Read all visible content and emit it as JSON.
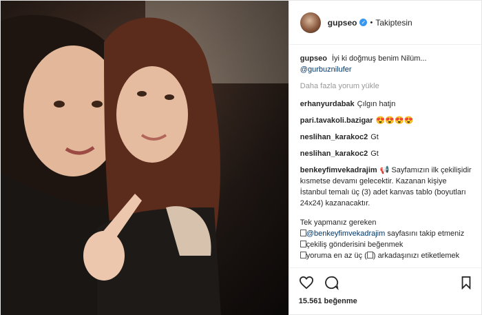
{
  "post": {
    "user": {
      "username": "gupseo",
      "verified": true,
      "follow_status": "Takiptesin"
    },
    "caption": {
      "username": "gupseo",
      "text": "İyi ki doğmuş benim Nilüm...",
      "mention": "@gurbuznilufer"
    },
    "load_more": "Daha fazla yorum yükle",
    "comments": [
      {
        "username": "erhanyurdabak",
        "text": "Çılgın hatjn"
      },
      {
        "username": "pari.tavakoli.bazigar",
        "text": "😍😍😍😍"
      },
      {
        "username": "neslihan_karakoc2",
        "text": "Gt"
      },
      {
        "username": "neslihan_karakoc2",
        "text": "Gt"
      }
    ],
    "promo": {
      "username": "benkeyfimvekadrajim",
      "line1": "📢 Sayfamızın ilk çekilişidir kısmetse devamı gelecektir. Kazanan kişiye İstanbul temalı üç (3) adet kanvas tablo (boyutları 24x24) kazanacaktır.",
      "line2": "Tek yapmanız gereken",
      "step1_mention": "@benkeyfimvekadrajim",
      "step1_text": " sayfasını takip etmeniz",
      "step2": "çekiliş gönderisini beğenmek",
      "step3_a": "yoruma en az üç (",
      "step3_b": ") arkadaşınızı etiketlemek"
    },
    "likes": "15.561 beğenme",
    "icons": {
      "like": "heart-icon",
      "comment": "comment-bubble-icon",
      "save": "bookmark-icon",
      "verified": "verified-badge-icon"
    },
    "colors": {
      "mention": "#003569",
      "verified": "#3897f0",
      "muted": "#999999"
    }
  }
}
